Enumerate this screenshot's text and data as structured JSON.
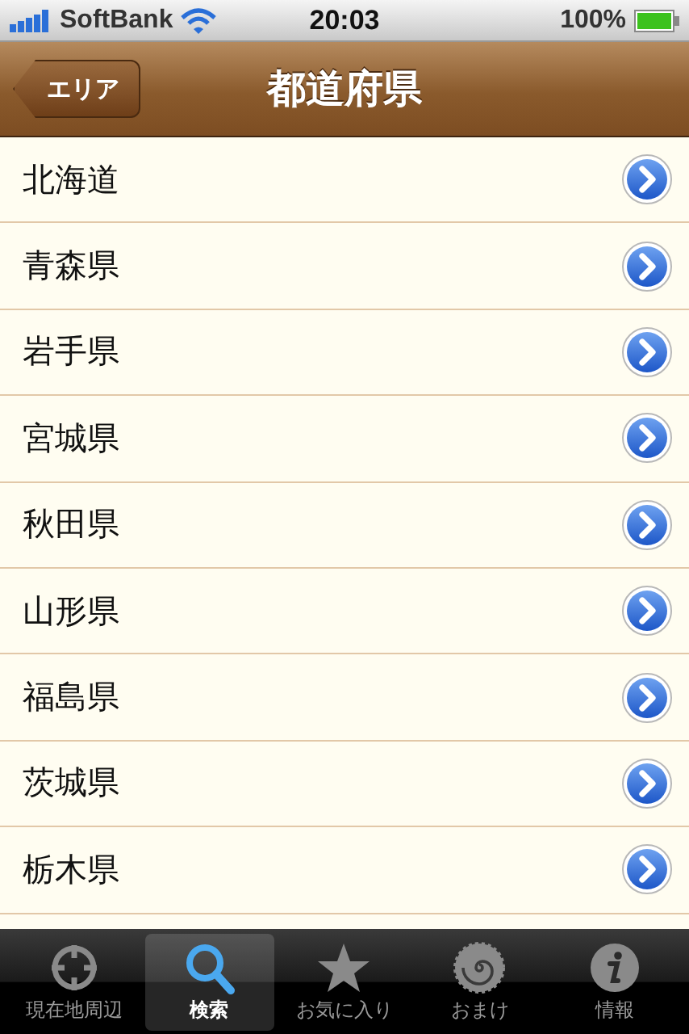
{
  "status_bar": {
    "carrier": "SoftBank",
    "time": "20:03",
    "battery": "100%"
  },
  "nav_bar": {
    "back_button": "エリア",
    "title": "都道府県"
  },
  "rows": [
    {
      "label": "北海道"
    },
    {
      "label": "青森県"
    },
    {
      "label": "岩手県"
    },
    {
      "label": "宮城県"
    },
    {
      "label": "秋田県"
    },
    {
      "label": "山形県"
    },
    {
      "label": "福島県"
    },
    {
      "label": "茨城県"
    },
    {
      "label": "栃木県"
    }
  ],
  "tab_bar": [
    {
      "label": "現在地周辺",
      "kind": "crosshair",
      "selected": false
    },
    {
      "label": "検索",
      "kind": "search",
      "selected": true
    },
    {
      "label": "お気に入り",
      "kind": "star",
      "selected": false
    },
    {
      "label": "おまけ",
      "kind": "spiral",
      "selected": false
    },
    {
      "label": "情報",
      "kind": "info",
      "selected": false
    }
  ]
}
